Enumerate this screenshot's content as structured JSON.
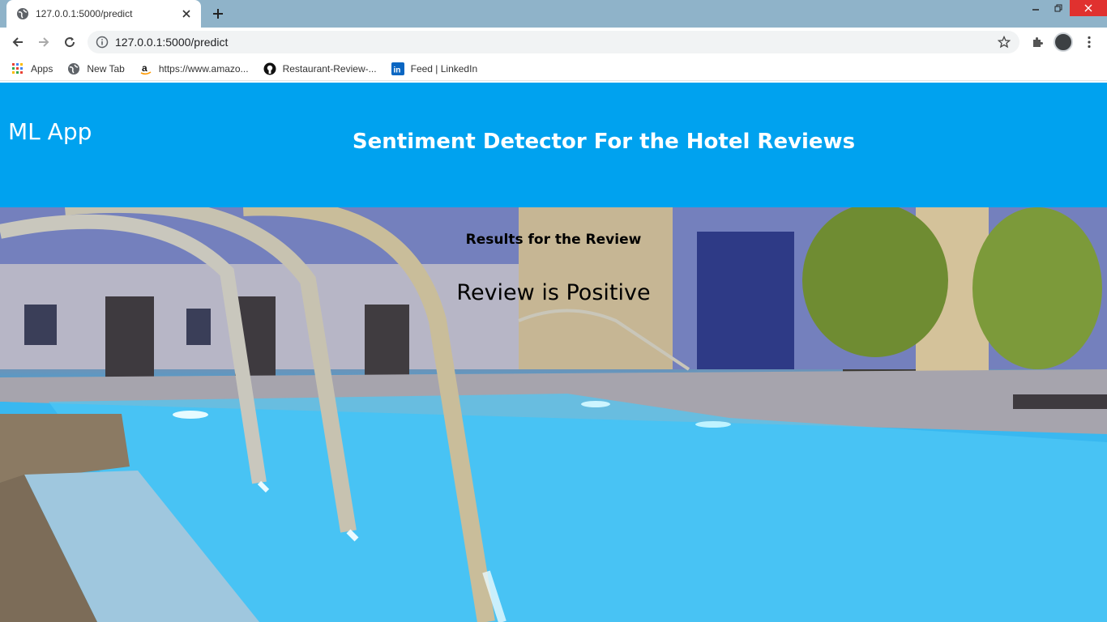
{
  "browser": {
    "tab_title": "127.0.0.1:5000/predict",
    "url": "127.0.0.1:5000/predict",
    "bookmarks": [
      {
        "label": "Apps",
        "icon": "apps-grid-icon"
      },
      {
        "label": "New Tab",
        "icon": "globe-icon"
      },
      {
        "label": "https://www.amazo...",
        "icon": "amazon-icon"
      },
      {
        "label": "Restaurant-Review-...",
        "icon": "github-icon"
      },
      {
        "label": "Feed | LinkedIn",
        "icon": "linkedin-icon"
      }
    ]
  },
  "app": {
    "brand": "ML App",
    "heading": "Sentiment Detector For the Hotel Reviews",
    "results_title": "Results for the Review",
    "results_text": "Review is Positive"
  },
  "colors": {
    "header_bg": "#00a2ef",
    "tabstrip_bg": "#8fb3c9",
    "close_button": "#e0312f"
  }
}
